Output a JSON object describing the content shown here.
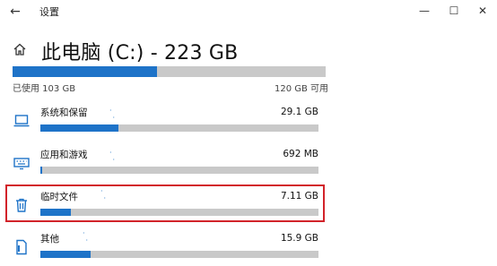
{
  "window": {
    "title": "设置",
    "back_glyph": "←",
    "minimize_glyph": "—",
    "maximize_glyph": "☐",
    "close_glyph": "✕"
  },
  "header": {
    "title": "此电脑 (C:) - 223 GB",
    "icon": "home-icon"
  },
  "storage": {
    "used_label": "已使用 103 GB",
    "available_label": "120 GB 可用",
    "used_fraction": 0.46,
    "accent_color": "#1e73c8",
    "track_color": "#c9c9c9",
    "highlight_color": "#d2232a"
  },
  "categories": [
    {
      "name": "系统和保留",
      "size": "29.1 GB",
      "fraction": 0.28,
      "icon": "laptop-icon"
    },
    {
      "name": "应用和游戏",
      "size": "692 MB",
      "fraction": 0.008,
      "icon": "keyboard-icon"
    },
    {
      "name": "临时文件",
      "size": "7.11 GB",
      "fraction": 0.11,
      "icon": "trash-icon",
      "highlighted": true
    },
    {
      "name": "其他",
      "size": "15.9 GB",
      "fraction": 0.18,
      "icon": "document-icon"
    }
  ]
}
